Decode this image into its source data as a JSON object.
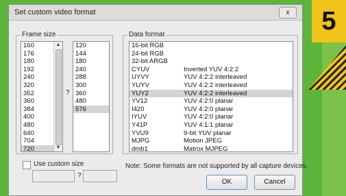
{
  "dialog": {
    "title": "Set custom video format",
    "close_glyph": "x"
  },
  "frame_size": {
    "legend": "Frame size",
    "widths": [
      "160",
      "176",
      "180",
      "192",
      "240",
      "320",
      "352",
      "360",
      "384",
      "400",
      "480",
      "640",
      "704",
      "720"
    ],
    "selected_width": "720",
    "separator": "?",
    "heights": [
      "120",
      "144",
      "180",
      "240",
      "288",
      "300",
      "360",
      "480",
      "576"
    ],
    "selected_height": "576"
  },
  "data_format": {
    "legend": "Data format",
    "formats": [
      {
        "code": "16-bit RGB",
        "desc": ""
      },
      {
        "code": "24-bit RGB",
        "desc": ""
      },
      {
        "code": "32-bit ARGB",
        "desc": ""
      },
      {
        "code": "CYUV",
        "desc": "Inverted YUV 4:2:2"
      },
      {
        "code": "UYVY",
        "desc": "YUV 4:2:2 interleaved"
      },
      {
        "code": "YUYV",
        "desc": "YUV 4:2:2 interleaved"
      },
      {
        "code": "YUY2",
        "desc": "YUV 4:2:2 interleaved"
      },
      {
        "code": "YV12",
        "desc": "YUV 4:2:0 planar"
      },
      {
        "code": "I420",
        "desc": "YUV 4:2:0 planar"
      },
      {
        "code": "IYUV",
        "desc": "YUV 4:2:0 planar"
      },
      {
        "code": "Y41P",
        "desc": "YUV 4:1:1 planar"
      },
      {
        "code": "YVU9",
        "desc": "9-bit YUV planar"
      },
      {
        "code": "MJPG",
        "desc": "Motion JPEG"
      },
      {
        "code": "dmb1",
        "desc": "Matrox MJPEG"
      }
    ],
    "selected_code": "YUY2"
  },
  "custom_size": {
    "checkbox_label": "Use custom size",
    "checked": false,
    "separator": "?",
    "width_value": "",
    "height_value": ""
  },
  "note": "Note: Some formats are not supported by all capture devices.",
  "buttons": {
    "ok": "OK",
    "cancel": "Cancel"
  },
  "badge": {
    "number": "5"
  },
  "colors": {
    "background": "#5ab53a",
    "badge": "#f0c419",
    "selection": "#d4d4d4"
  }
}
